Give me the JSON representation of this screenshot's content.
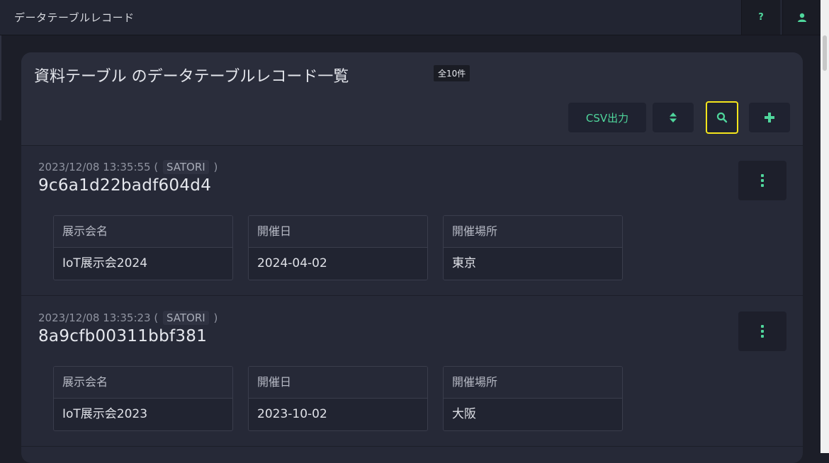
{
  "topbar": {
    "title": "データテーブルレコード",
    "help_icon_label": "?",
    "icons": [
      "help-icon",
      "user-icon"
    ]
  },
  "panel": {
    "title": "資料テーブル のデータテーブルレコード一覧",
    "count": "全10件",
    "csv_label": "CSV出力",
    "icons": [
      "sort-icon",
      "search-icon",
      "plus-icon",
      "kebab-menu-icon"
    ]
  },
  "records": [
    {
      "timestamp": "2023/12/08 13:35:55 (",
      "user": "SATORI",
      "close": ")",
      "id": "9c6a1d22badf604d4",
      "fields": [
        {
          "label": "展示会名",
          "value": "IoT展示会2024"
        },
        {
          "label": "開催日",
          "value": "2024-04-02"
        },
        {
          "label": "開催場所",
          "value": "東京"
        }
      ]
    },
    {
      "timestamp": "2023/12/08 13:35:23 (",
      "user": "SATORI",
      "close": ")",
      "id": "8a9cfb00311bbf381",
      "fields": [
        {
          "label": "展示会名",
          "value": "IoT展示会2023"
        },
        {
          "label": "開催日",
          "value": "2023-10-02"
        },
        {
          "label": "開催場所",
          "value": "大阪"
        }
      ]
    }
  ],
  "colors": {
    "accent": "#4fd69c",
    "highlight": "#f5e51c",
    "background": "#1c1e28"
  }
}
